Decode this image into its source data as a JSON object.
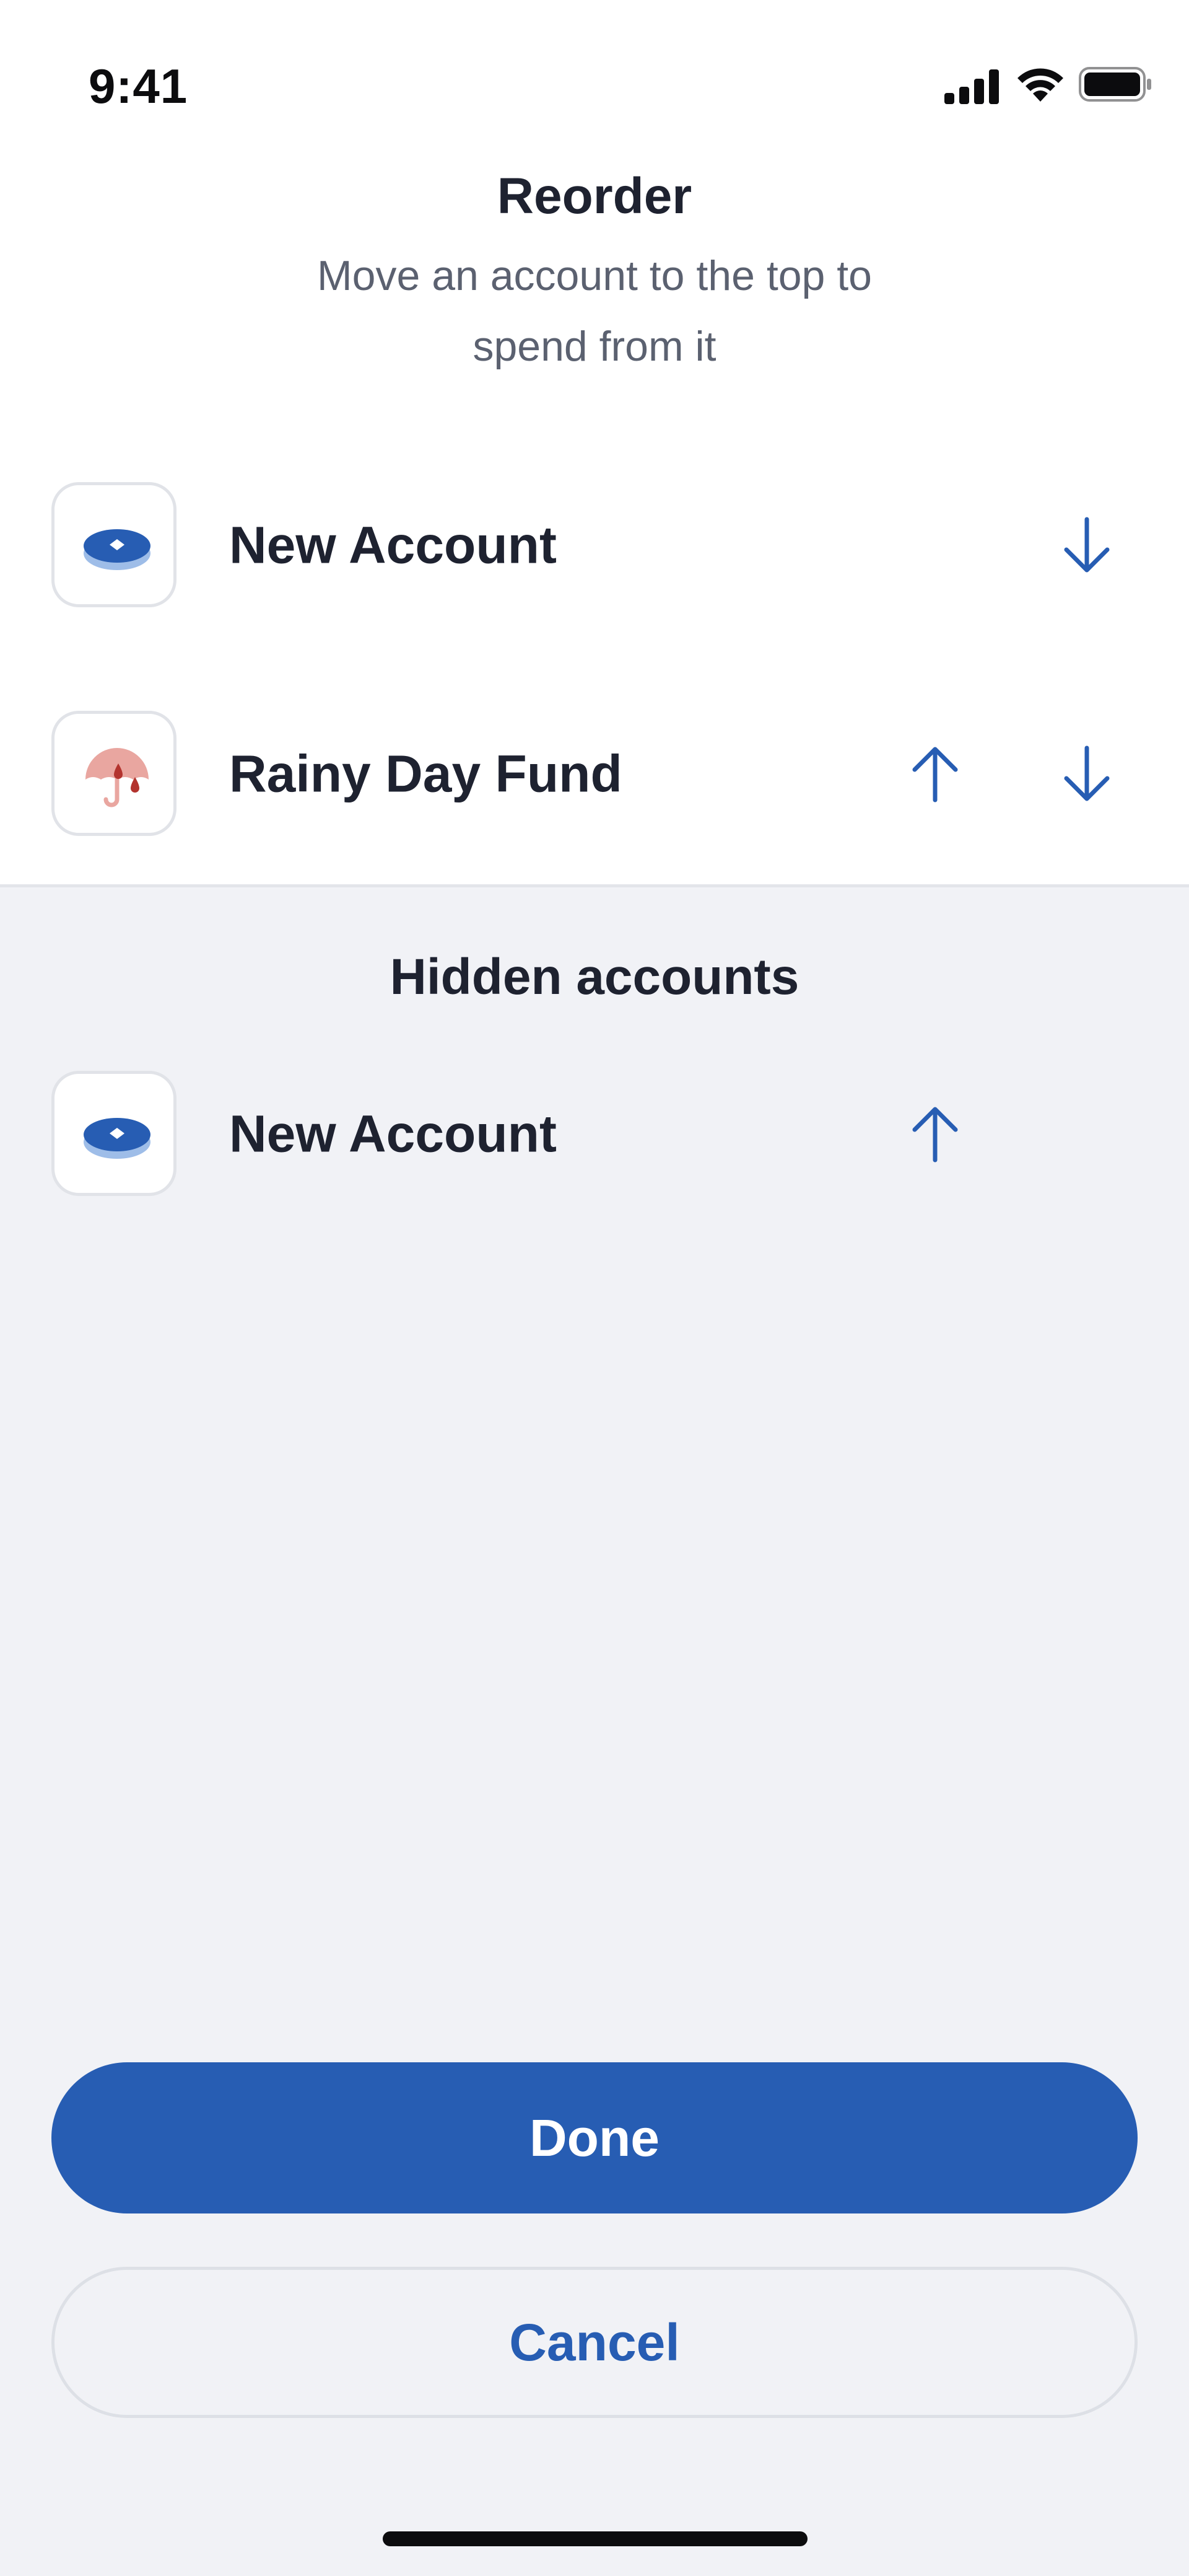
{
  "status_bar": {
    "time": "9:41",
    "icons": [
      "cellular-signal-icon",
      "wifi-icon",
      "battery-icon"
    ]
  },
  "header": {
    "title": "Reorder",
    "subtitle": "Move an account to the top to spend from it"
  },
  "visible_accounts": [
    {
      "name": "New Account",
      "icon": "savings-pot-icon",
      "actions": [
        "move-down"
      ]
    },
    {
      "name": "Rainy Day Fund",
      "icon": "umbrella-icon",
      "actions": [
        "move-up",
        "move-down"
      ]
    }
  ],
  "hidden_section": {
    "heading": "Hidden accounts",
    "accounts": [
      {
        "name": "New Account",
        "icon": "savings-pot-icon",
        "actions": [
          "move-up"
        ]
      }
    ]
  },
  "buttons": {
    "done": "Done",
    "cancel": "Cancel"
  },
  "colors": {
    "accent": "#275DB3",
    "background": "#F1F2F6",
    "surface": "#FFFFFF",
    "text": "#1E2230",
    "muted_text": "#5B6170",
    "umbrella_pink": "#E9A6A0",
    "umbrella_drop": "#B3332E"
  }
}
